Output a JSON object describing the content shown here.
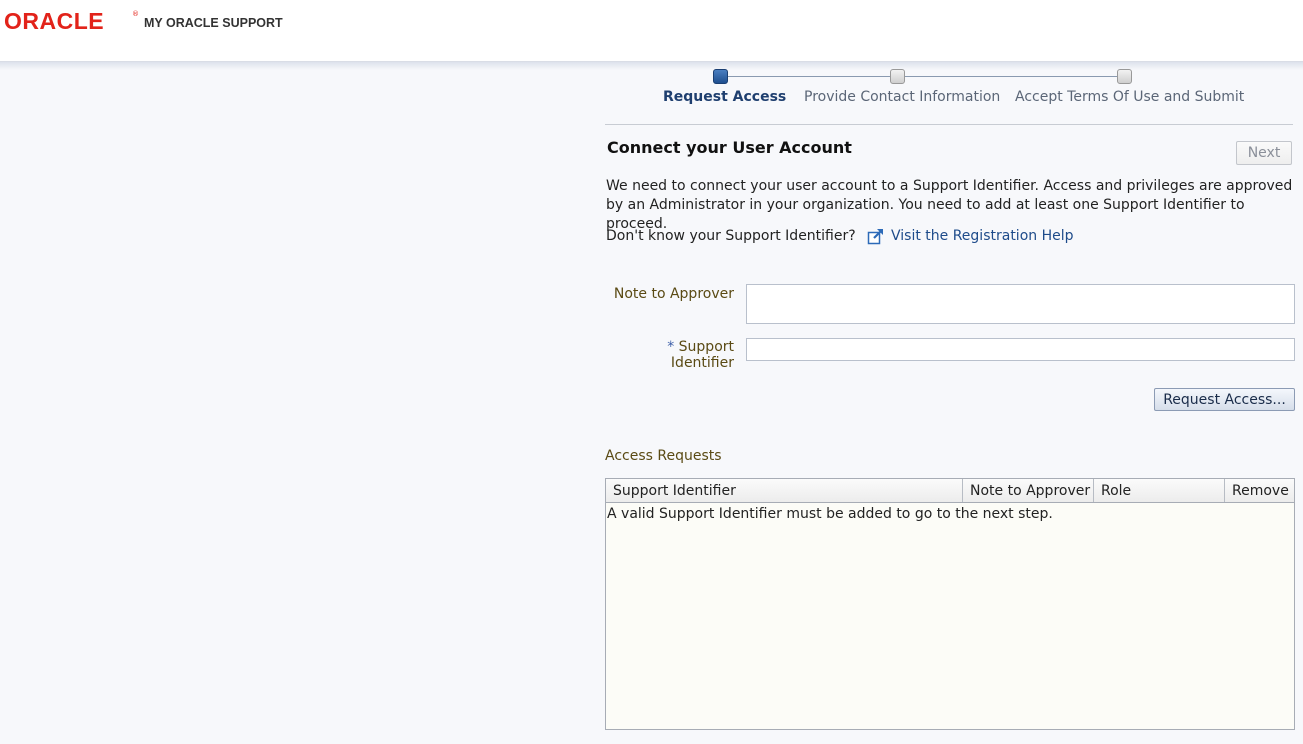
{
  "header": {
    "brand": "ORACLE",
    "registered": "®",
    "product": "MY ORACLE SUPPORT"
  },
  "train": {
    "steps": [
      {
        "label": "Request Access",
        "state": "active"
      },
      {
        "label": "Provide Contact Information",
        "state": "inactive"
      },
      {
        "label": "Accept Terms Of Use and Submit",
        "state": "inactive"
      }
    ]
  },
  "section": {
    "title": "Connect your User Account",
    "next_label": "Next",
    "description": "We need to connect your user account to a Support Identifier. Access and privileges are approved by an Administrator in your organization. You need to add at least one Support Identifier to proceed.",
    "help_question": "Don't know your Support Identifier?",
    "help_link": "Visit the Registration Help"
  },
  "form": {
    "note_label": "Note to Approver",
    "note_value": "",
    "required_marker": "*",
    "sid_label": "Support Identifier",
    "sid_value": "",
    "request_button": "Request Access..."
  },
  "access_requests": {
    "title": "Access Requests",
    "columns": [
      "Support Identifier",
      "Note to Approver",
      "Role",
      "Remove"
    ],
    "empty_message": "A valid Support Identifier must be added to go to the next step."
  },
  "colors": {
    "brand_red": "#e2231a",
    "link_blue": "#1e4b8a",
    "label_brown": "#5a4a14",
    "active_step": "#1f3f6f"
  }
}
